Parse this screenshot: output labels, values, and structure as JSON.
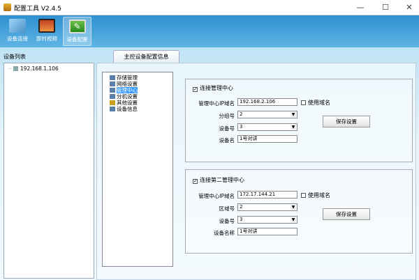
{
  "window": {
    "title": "配置工具 V2.4.5",
    "controls": [
      "minimize",
      "maximize",
      "close"
    ]
  },
  "toolbar": {
    "items": [
      {
        "label": "设备连接",
        "icon": "network-computers-icon"
      },
      {
        "label": "即时视频",
        "icon": "video-monitor-icon"
      },
      {
        "label": "设备配置",
        "icon": "config-wrench-icon",
        "selected": true
      }
    ]
  },
  "device_list": {
    "label": "设备列表",
    "items": [
      "192.168.1.106"
    ]
  },
  "tab": {
    "label": "主控设备配置信息"
  },
  "tree": {
    "items": [
      "存储管理",
      "网络设置",
      "管理中心",
      "分机设置",
      "其他设置",
      "设备信息"
    ],
    "selected": "管理中心"
  },
  "group1": {
    "checkbox_label": "连接管理中心",
    "checked": true,
    "ip_label": "管理中心IP域名",
    "ip_value": "192.168.2.106",
    "use_domain_label": "使用域名",
    "use_domain_checked": false,
    "group_label": "分组号",
    "group_value": "2",
    "device_no_label": "设备号",
    "device_no_value": "3",
    "device_name_label": "设备名",
    "device_name_value": "1号对讲",
    "save_label": "保存设置"
  },
  "group2": {
    "checkbox_label": "连接第二管理中心",
    "checked": true,
    "ip_label": "管理中心IP域名",
    "ip_value": "172.17.144.21",
    "use_domain_label": "使用域名",
    "use_domain_checked": false,
    "area_label": "区域号",
    "area_value": "2",
    "device_no_label": "设备号",
    "device_no_value": "3",
    "device_name_label": "设备名称",
    "device_name_value": "1号对讲",
    "save_label": "保存设置"
  },
  "colors": {
    "toolbar": "#3a9fd8",
    "selection": "#3399ff"
  }
}
